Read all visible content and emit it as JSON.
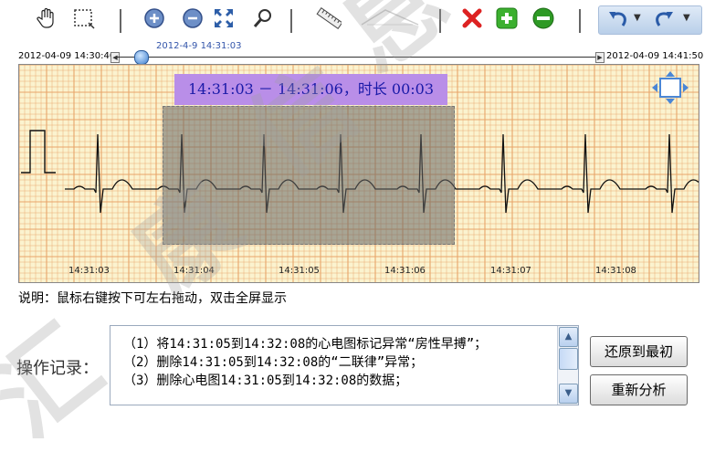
{
  "toolbar": {
    "icons": [
      "hand-pan-icon",
      "select-rect-icon",
      "zoom-in-icon",
      "zoom-out-icon",
      "fit-screen-icon",
      "magnifier-icon",
      "ruler-icon",
      "ruler-disabled-icon",
      "delete-icon",
      "add-icon",
      "remove-icon",
      "undo-icon",
      "redo-icon"
    ]
  },
  "timeline": {
    "start": "2012-04-09 14:30:40",
    "end": "2012-04-09 14:41:50",
    "current": "2012-4-9 14:31:03",
    "position_fraction": 0.05
  },
  "ecg": {
    "selection_label": "14:31:03 － 14:31:06，时长 00:03",
    "time_marks": [
      "14:31:03",
      "14:31:04",
      "14:31:05",
      "14:31:06",
      "14:31:07",
      "14:31:08"
    ],
    "grid_color": "#e8a46a",
    "background": "#fbf3cf"
  },
  "hint": "说明：鼠标右键按下可左右拖动，双击全屏显示",
  "operations": {
    "label": "操作记录：",
    "log": [
      "（1）将14:31:05到14:32:08的心电图标记异常“房性早搏”；",
      "（2）删除14:31:05到14:32:08的“二联律”异常；",
      "（3）删除心电图14:31:05到14:32:08的数据；"
    ]
  },
  "buttons": {
    "restore": "还原到最初",
    "reanalyze": "重新分析"
  },
  "watermark": "汇康信息"
}
